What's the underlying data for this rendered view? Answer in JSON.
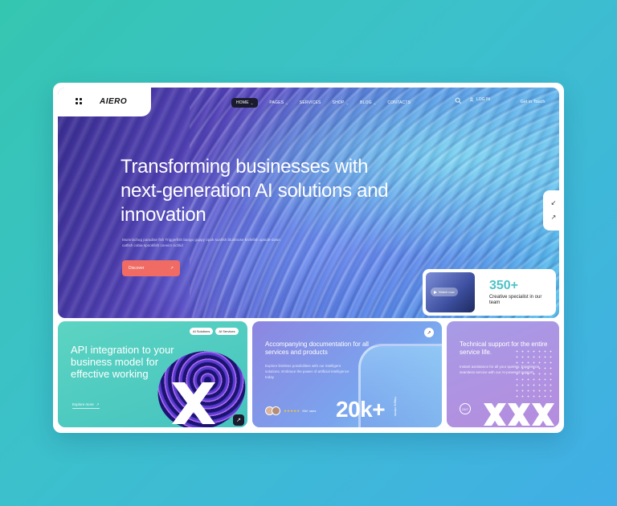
{
  "brand": "AIERO",
  "nav": {
    "items": [
      {
        "label": "HOME",
        "caret": "⌄"
      },
      {
        "label": "PAGES",
        "caret": "⌄"
      },
      {
        "label": "SERVICES",
        "caret": ""
      },
      {
        "label": "SHOP",
        "caret": "⌄"
      },
      {
        "label": "BLOG",
        "caret": "⌄"
      },
      {
        "label": "CONTACTS",
        "caret": ""
      }
    ],
    "login": "LOG IN",
    "cta": "Get in Touch"
  },
  "hero": {
    "title": "Transforming businesses with next-generation AI solutions and innovation",
    "subtitle": "Mummichog paradise fish Triggerfish bango guppy opah sunfish bluntnose knifefish upside-down catfish cobia spookfish convict cichlid",
    "button": "Discover",
    "button_arrow": "↗"
  },
  "side_controls": {
    "shrink": "↙",
    "expand": "↗"
  },
  "specialist_card": {
    "watch": "Watch now",
    "number": "350+",
    "label": "Creative specialist in our team"
  },
  "card_api": {
    "chips": [
      "AI Solutions",
      "AI Services"
    ],
    "title": "API integration to your business model for effective working",
    "link": "Explore more",
    "link_arrow": "↗",
    "corner_arrow": "↗"
  },
  "card_docs": {
    "title": "Accompanying documentation for all services and products",
    "text": "Explore limitless possibilities with our intelligent solutions. Embrace the power of artificial intelligence today",
    "corner_arrow": "↗",
    "stars": "★★★★★",
    "reviews": "20k+ users",
    "number": "20k+",
    "vertical": "Happy clients"
  },
  "card_support": {
    "title": "Technical support for the entire service life.",
    "text": "Instant assistance for all your queries. Experience seamless service with our AI-powered support",
    "badge": "24/7"
  },
  "colors": {
    "accent_coral": "#ef6b63",
    "teal": "#4ec2c8",
    "dark": "#1b1b2e"
  }
}
